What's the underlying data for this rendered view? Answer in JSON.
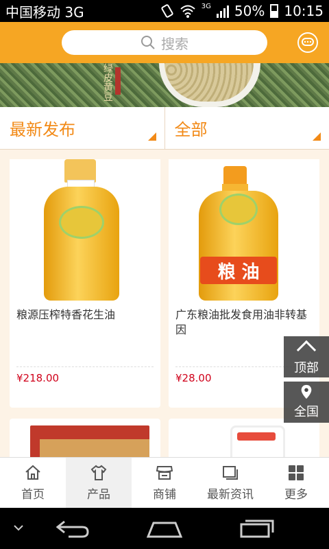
{
  "status_bar": {
    "carrier": "中国移动 3G",
    "network": "3G",
    "battery": "50%",
    "time": "10:15"
  },
  "header": {
    "search_placeholder": "搜索"
  },
  "banner": {
    "text": "绿皮黄豆"
  },
  "filters": {
    "sort_label": "最新发布",
    "category_label": "全部"
  },
  "products": [
    {
      "name": "粮源压榨特香花生油",
      "price": "¥218.00"
    },
    {
      "name": "广东粮油批发食用油非转基因",
      "price": "¥28.00"
    }
  ],
  "floating": {
    "top_label": "顶部",
    "region_label": "全国"
  },
  "tabs": [
    {
      "label": "首页",
      "icon": "home-icon"
    },
    {
      "label": "产品",
      "icon": "shirt-icon"
    },
    {
      "label": "商铺",
      "icon": "store-icon"
    },
    {
      "label": "最新资讯",
      "icon": "news-icon"
    },
    {
      "label": "更多",
      "icon": "grid-icon"
    }
  ],
  "colors": {
    "brand": "#f6a623",
    "accent": "#f28a17",
    "price": "#d0021b"
  }
}
